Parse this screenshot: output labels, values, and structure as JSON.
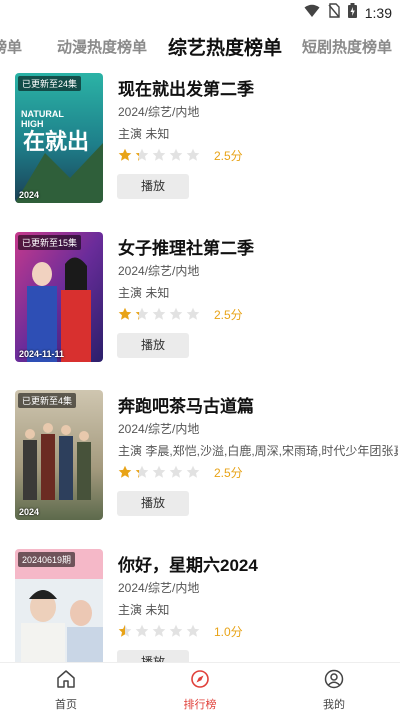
{
  "status_bar": {
    "time": "1:39",
    "icons": [
      "wifi-icon",
      "no-sim-icon",
      "battery-icon"
    ]
  },
  "tabs": [
    {
      "label": "榜单",
      "active": false
    },
    {
      "label": "动漫热度榜单",
      "active": false
    },
    {
      "label": "综艺热度榜单",
      "active": true
    },
    {
      "label": "短剧热度榜单",
      "active": false
    }
  ],
  "accent_color": "#e0403a",
  "star_color": "#e8a317",
  "items": [
    {
      "title": "现在就出发第二季",
      "meta": "2024/综艺/内地",
      "cast": "主演 未知",
      "rating": 2.5,
      "score_text": "2.5分",
      "play_label": "播放",
      "badge": "已更新至24集",
      "poster_year": "2024",
      "poster_text": "NATURAL HIGH"
    },
    {
      "title": "女子推理社第二季",
      "meta": "2024/综艺/内地",
      "cast": "主演 未知",
      "rating": 2.5,
      "score_text": "2.5分",
      "play_label": "播放",
      "badge": "已更新至15集",
      "poster_year": "2024-11-11",
      "poster_text": ""
    },
    {
      "title": "奔跑吧茶马古道篇",
      "meta": "2024/综艺/内地",
      "cast": "主演 李晨,郑恺,沙溢,白鹿,周深,宋雨琦,时代少年团张真源",
      "rating": 2.5,
      "score_text": "2.5分",
      "play_label": "播放",
      "badge": "已更新至4集",
      "poster_year": "2024",
      "poster_text": ""
    },
    {
      "title": "你好，星期六2024",
      "meta": "2024/综艺/内地",
      "cast": "主演 未知",
      "rating": 1.0,
      "score_text": "1.0分",
      "play_label": "播放",
      "badge": "20240619期",
      "poster_year": "",
      "poster_text": ""
    }
  ],
  "bottom_nav": [
    {
      "label": "首页",
      "icon": "home-icon",
      "active": false
    },
    {
      "label": "排行榜",
      "icon": "compass-icon",
      "active": true
    },
    {
      "label": "我的",
      "icon": "profile-icon",
      "active": false
    }
  ]
}
